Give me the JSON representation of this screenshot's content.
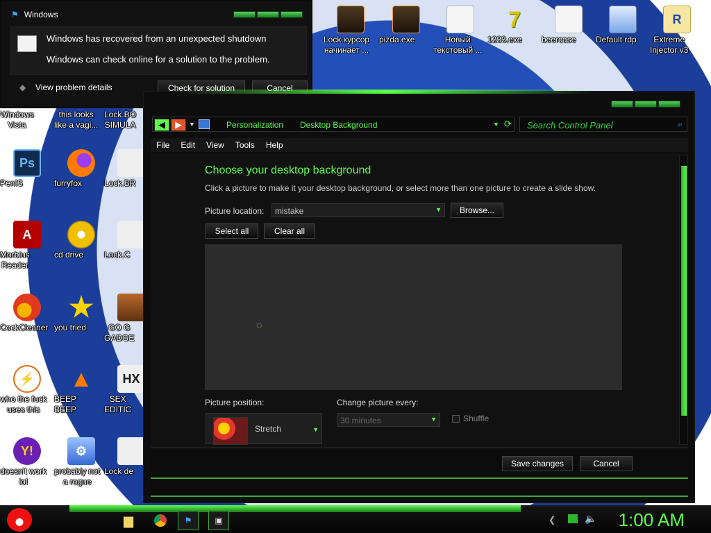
{
  "desktop": {
    "icons": [
      {
        "label": "Lock.курсор\nначинает ..."
      },
      {
        "label": "pizda.exe"
      },
      {
        "label": "Новый\nтекстовый ..."
      },
      {
        "label": "1233.exe"
      },
      {
        "label": "beercase"
      },
      {
        "label": "Default rdp"
      },
      {
        "label": "Extreme\nInjector v3"
      },
      {
        "label": "Windows\nVista"
      },
      {
        "label": "this looks\nlike a vagi..."
      },
      {
        "label": "Lock.BO\nSIMULA"
      },
      {
        "label": "PenIS"
      },
      {
        "label": "furryfox"
      },
      {
        "label": "Lock.BR"
      },
      {
        "label": "Morbius\nReader"
      },
      {
        "label": "cd drive"
      },
      {
        "label": "Lock.C"
      },
      {
        "label": "CockCleaner"
      },
      {
        "label": "you tried"
      },
      {
        "label": "GO G\nGADGE"
      },
      {
        "label": "who the fuck\nuses this"
      },
      {
        "label": "BEEP\nBEEP"
      },
      {
        "label": "SEX\nEDITIC"
      },
      {
        "label": "doesn't work\nlol"
      },
      {
        "label": "probably not\na rogue"
      },
      {
        "label": "Lock de"
      }
    ]
  },
  "notification": {
    "title": "Windows",
    "message1": "Windows has recovered from an unexpected shutdown",
    "message2": "Windows can check online for a solution to the problem.",
    "details_label": "View problem details",
    "check_label": "Check for solution",
    "cancel_label": "Cancel"
  },
  "window": {
    "breadcrumb": [
      "Personalization",
      "Desktop Background"
    ],
    "search_placeholder": "Search Control Panel",
    "menu": [
      "File",
      "Edit",
      "View",
      "Tools",
      "Help"
    ],
    "heading": "Choose your desktop background",
    "subheading": "Click a picture to make it your desktop background, or select more than one picture to create a slide show.",
    "picture_location_label": "Picture location:",
    "picture_location_value": "mistake",
    "browse_label": "Browse...",
    "select_all_label": "Select all",
    "clear_all_label": "Clear all",
    "picture_position_label": "Picture position:",
    "picture_position_value": "Stretch",
    "change_every_label": "Change picture every:",
    "change_every_value": "30 minutes",
    "shuffle_label": "Shuffle",
    "save_label": "Save changes",
    "cancel_label": "Cancel"
  },
  "taskbar": {
    "clock": "1:00 AM"
  },
  "colors": {
    "accent": "#5bff4a",
    "window_bg": "#0d0d0d"
  }
}
